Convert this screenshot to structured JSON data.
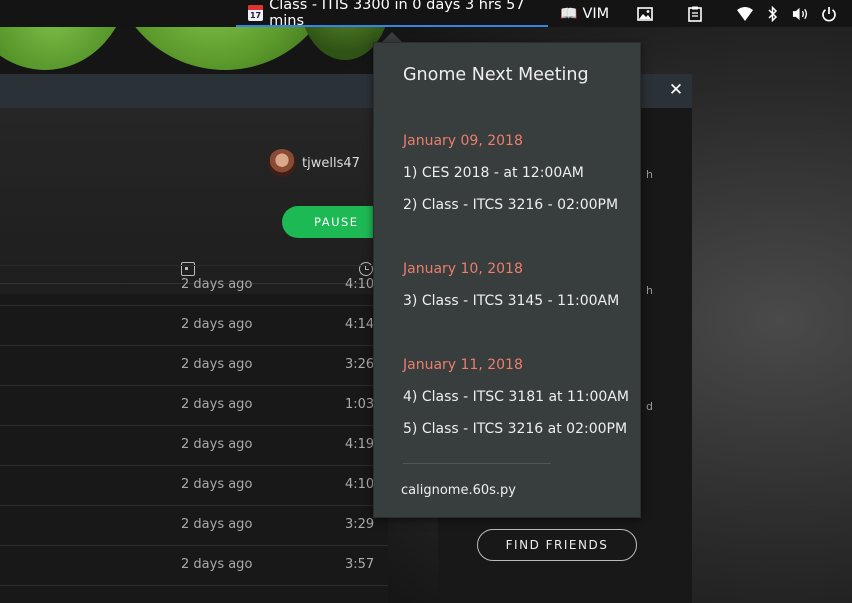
{
  "topbar": {
    "clock_label": "Class - ITIS 3300 in 0 days 3 hrs 57 mins",
    "calendar_day": "17",
    "vim_label": "VIM",
    "icons": [
      "calendar-icon",
      "book-icon",
      "image-icon",
      "clipboard-icon",
      "wifi-icon",
      "bluetooth-icon",
      "volume-icon",
      "power-icon"
    ]
  },
  "app": {
    "username": "tjwells47",
    "pause_label": "PAUSE",
    "rows": [
      {
        "ago": "2 days ago",
        "dur": "4:10"
      },
      {
        "ago": "2 days ago",
        "dur": "4:14"
      },
      {
        "ago": "2 days ago",
        "dur": "3:26"
      },
      {
        "ago": "2 days ago",
        "dur": "1:03"
      },
      {
        "ago": "2 days ago",
        "dur": "4:19"
      },
      {
        "ago": "2 days ago",
        "dur": "4:10"
      },
      {
        "ago": "2 days ago",
        "dur": "3:29"
      },
      {
        "ago": "2 days ago",
        "dur": "3:57"
      }
    ]
  },
  "friends": {
    "close_label": "✕",
    "hints": [
      "h",
      "h",
      "d"
    ],
    "find_friends_label": "FIND FRIENDS"
  },
  "popup": {
    "title": "Gnome Next Meeting",
    "groups": [
      {
        "date": "January 09, 2018",
        "items": [
          "1) CES 2018 -  at 12:00AM",
          "2) Class - ITCS 3216 -  02:00PM"
        ]
      },
      {
        "date": "January 10, 2018",
        "items": [
          "3) Class - ITCS 3145 -  11:00AM"
        ]
      },
      {
        "date": "January 11, 2018",
        "items": [
          "4) Class - ITSC 3181 at  11:00AM",
          "5) Class - ITCS 3216 at  02:00PM"
        ]
      }
    ],
    "footer": "calignome.60s.py"
  },
  "colors": {
    "accent": "#3584e4",
    "spotify_green": "#1db954",
    "date_red": "#ed7d6c"
  }
}
